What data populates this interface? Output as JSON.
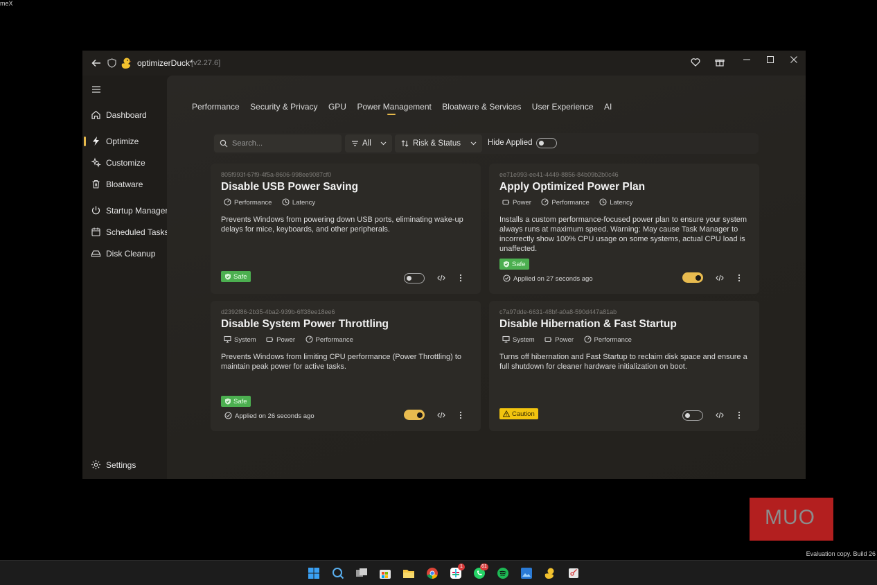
{
  "corner_text": "meX",
  "window": {
    "title": "optimizerDuck*",
    "version": "[v2.27.6]"
  },
  "sidebar": {
    "items": [
      {
        "label": "Dashboard",
        "icon": "home-icon"
      },
      {
        "label": "Optimize",
        "icon": "lightning-icon",
        "active": true
      },
      {
        "label": "Customize",
        "icon": "sparkle-icon"
      },
      {
        "label": "Bloatware",
        "icon": "trash-icon"
      },
      {
        "label": "Startup Manager",
        "icon": "power-icon"
      },
      {
        "label": "Scheduled Tasks",
        "icon": "calendar-icon"
      },
      {
        "label": "Disk Cleanup",
        "icon": "drive-icon"
      }
    ],
    "settings_label": "Settings"
  },
  "tabs": [
    {
      "label": "Performance"
    },
    {
      "label": "Security & Privacy"
    },
    {
      "label": "GPU"
    },
    {
      "label": "Power Management",
      "active": true
    },
    {
      "label": "Bloatware & Services"
    },
    {
      "label": "User Experience"
    },
    {
      "label": "AI"
    }
  ],
  "toolbar": {
    "search_placeholder": "Search...",
    "filter_label": "All",
    "sort_label": "Risk  &  Status",
    "hide_applied_label": "Hide Applied",
    "hide_applied_on": false
  },
  "cards": [
    {
      "id": "805f993f-67f9-4f5a-8606-998ee9087cf0",
      "title": "Disable USB Power Saving",
      "tags": [
        {
          "label": "Performance",
          "icon": "gauge-icon"
        },
        {
          "label": "Latency",
          "icon": "clock-icon"
        }
      ],
      "description": "Prevents Windows from powering down USB ports, eliminating wake-up delays for mice, keyboards, and other peripherals.",
      "risk": "Safe",
      "applied_text": "",
      "enabled": false
    },
    {
      "id": "ee71e993-ee41-4449-8856-84b09b2b0c46",
      "title": "Apply Optimized Power Plan",
      "tags": [
        {
          "label": "Power",
          "icon": "battery-icon"
        },
        {
          "label": "Performance",
          "icon": "gauge-icon"
        },
        {
          "label": "Latency",
          "icon": "clock-icon"
        }
      ],
      "description": "Installs a custom performance-focused power plan to ensure your system always runs at maximum speed. Warning: May cause Task Manager to incorrectly show 100% CPU usage on some systems, actual CPU load is unaffected.",
      "risk": "Safe",
      "applied_text": "Applied on 27 seconds ago",
      "enabled": true
    },
    {
      "id": "d2392f86-2b35-4ba2-939b-6ff38ee18ee6",
      "title": "Disable System Power Throttling",
      "tags": [
        {
          "label": "System",
          "icon": "monitor-icon"
        },
        {
          "label": "Power",
          "icon": "battery-icon"
        },
        {
          "label": "Performance",
          "icon": "gauge-icon"
        }
      ],
      "description": "Prevents Windows from limiting CPU performance (Power Throttling) to maintain peak power for active tasks.",
      "risk": "Safe",
      "applied_text": "Applied on 26 seconds ago",
      "enabled": true
    },
    {
      "id": "c7a97dde-6631-48bf-a0a8-590d447a81ab",
      "title": "Disable Hibernation & Fast Startup",
      "tags": [
        {
          "label": "System",
          "icon": "monitor-icon"
        },
        {
          "label": "Power",
          "icon": "battery-icon"
        },
        {
          "label": "Performance",
          "icon": "gauge-icon"
        }
      ],
      "description": "Turns off hibernation and Fast Startup to reclaim disk space and ensure a full shutdown for cleaner hardware initialization on boot.",
      "risk": "Caution",
      "applied_text": "",
      "enabled": false
    }
  ],
  "watermark": {
    "logo_text": "MUO",
    "eval_text": "Evaluation copy. Build 26"
  },
  "taskbar": {
    "badges": [
      "1",
      "61"
    ]
  },
  "colors": {
    "accent": "#e8bb4f",
    "safe": "#4caf50",
    "caution": "#f2c40f",
    "watermark_red": "#b31f1f"
  }
}
